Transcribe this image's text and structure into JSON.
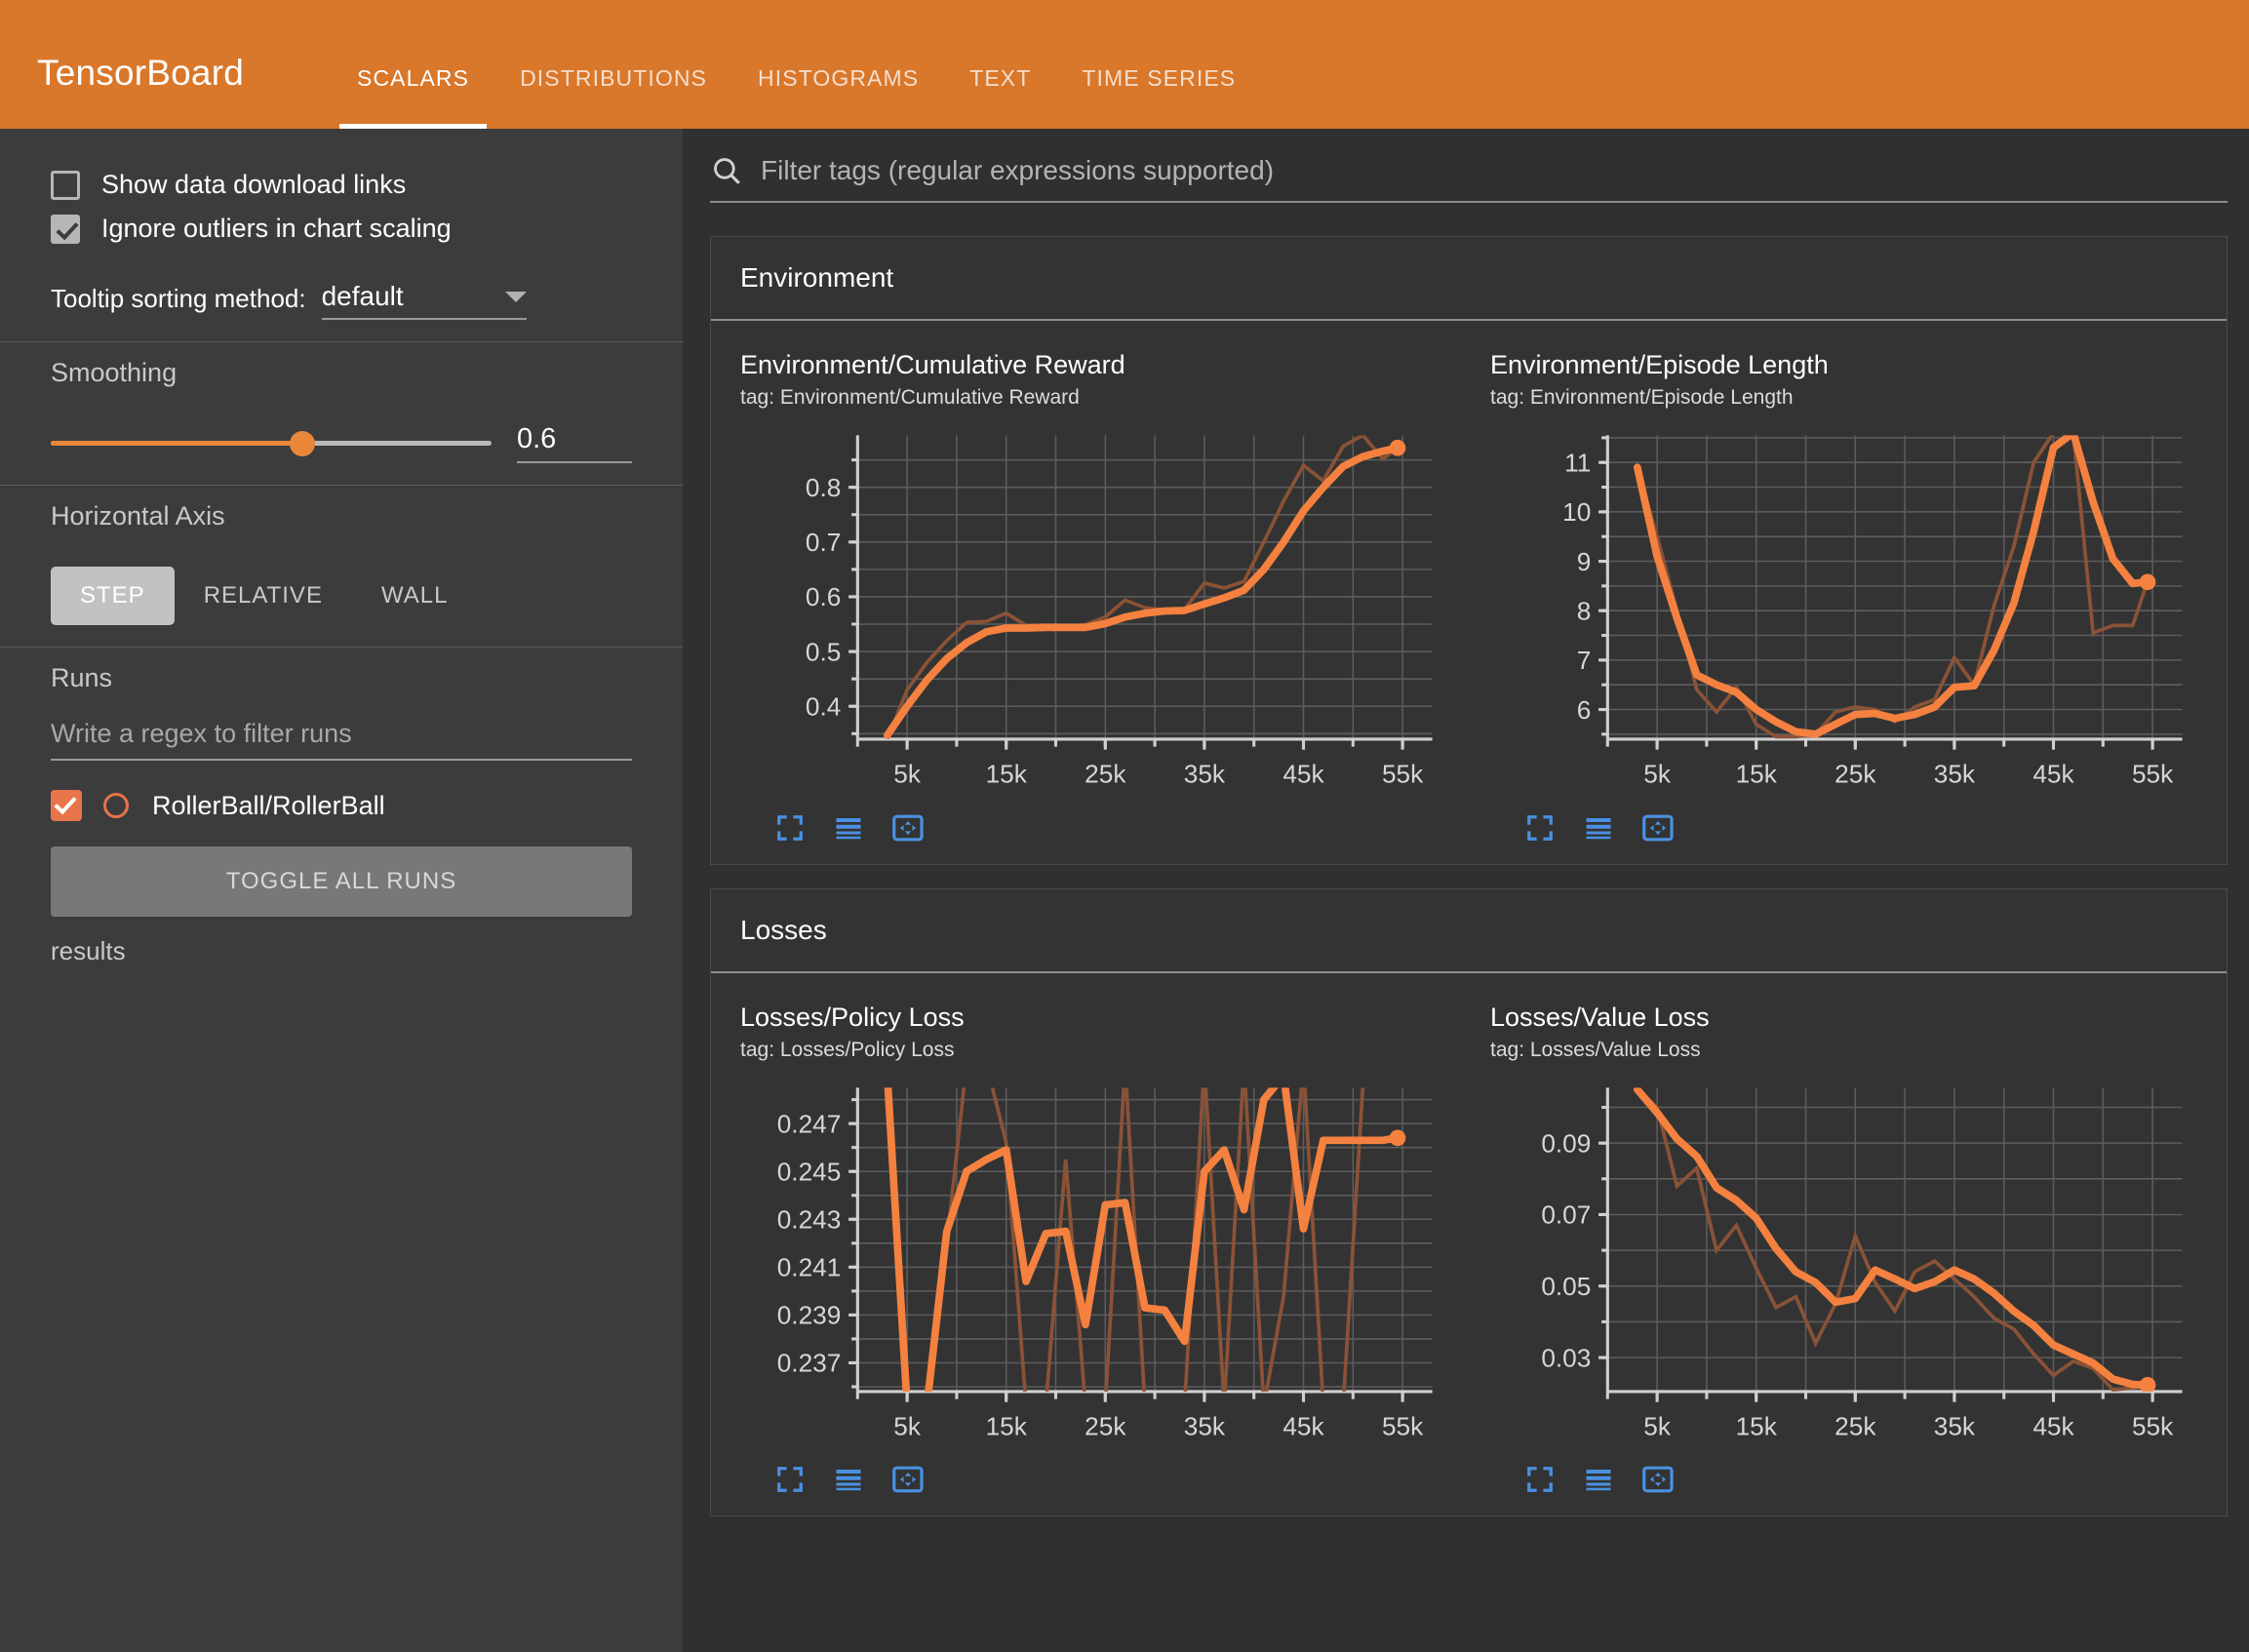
{
  "header": {
    "brand": "TensorBoard",
    "tabs": [
      {
        "label": "SCALARS",
        "active": true
      },
      {
        "label": "DISTRIBUTIONS",
        "active": false
      },
      {
        "label": "HISTOGRAMS",
        "active": false
      },
      {
        "label": "TEXT",
        "active": false
      },
      {
        "label": "TIME SERIES",
        "active": false
      }
    ],
    "accent_color": "#d9772a"
  },
  "sidebar": {
    "show_download_links": {
      "label": "Show data download links",
      "checked": false
    },
    "ignore_outliers": {
      "label": "Ignore outliers in chart scaling",
      "checked": true
    },
    "tooltip_sorting": {
      "label": "Tooltip sorting method:",
      "value": "default"
    },
    "smoothing": {
      "label": "Smoothing",
      "value": "0.6",
      "percent": 57
    },
    "horizontal_axis": {
      "label": "Horizontal Axis",
      "options": [
        "STEP",
        "RELATIVE",
        "WALL"
      ],
      "selected": "STEP"
    },
    "runs": {
      "label": "Runs",
      "filter_placeholder": "Write a regex to filter runs",
      "items": [
        {
          "name": "RollerBall/RollerBall",
          "checked": true,
          "color": "#e8744a"
        }
      ],
      "toggle_label": "TOGGLE ALL RUNS",
      "results_text": "results"
    }
  },
  "main": {
    "filter_placeholder": "Filter tags (regular expressions supported)",
    "groups": [
      {
        "name": "Environment",
        "charts": [
          {
            "title": "Environment/Cumulative Reward",
            "tag": "tag: Environment/Cumulative Reward"
          },
          {
            "title": "Environment/Episode Length",
            "tag": "tag: Environment/Episode Length"
          }
        ]
      },
      {
        "name": "Losses",
        "charts": [
          {
            "title": "Losses/Policy Loss",
            "tag": "tag: Losses/Policy Loss"
          },
          {
            "title": "Losses/Value Loss",
            "tag": "tag: Losses/Value Loss"
          }
        ]
      }
    ],
    "chart_tools": [
      "expand-icon",
      "data-table-icon",
      "pan-icon"
    ]
  },
  "chart_data": [
    {
      "type": "line",
      "title": "Environment/Cumulative Reward",
      "tag": "Environment/Cumulative Reward",
      "xlabel": "",
      "ylabel": "",
      "xlim": [
        0,
        58000
      ],
      "ylim": [
        0.34,
        0.895
      ],
      "xticks": [
        5000,
        15000,
        25000,
        35000,
        45000,
        55000
      ],
      "xticklabels": [
        "5k",
        "15k",
        "25k",
        "35k",
        "45k",
        "55k"
      ],
      "yticks": [
        0.4,
        0.5,
        0.6,
        0.7,
        0.8
      ],
      "yticklabels": [
        "0.4",
        "0.5",
        "0.6",
        "0.7",
        "0.8"
      ],
      "grid": true,
      "legend": false,
      "series": [
        {
          "name": "RollerBall/RollerBall (raw)",
          "color": "#8a5236",
          "x": [
            3000,
            5000,
            7000,
            9000,
            11000,
            13000,
            15000,
            17000,
            19000,
            21000,
            23000,
            25000,
            27000,
            29000,
            31000,
            33000,
            35000,
            37000,
            39000,
            41000,
            43000,
            45000,
            47000,
            49000,
            51000,
            53000,
            54500
          ],
          "y": [
            0.34,
            0.43,
            0.48,
            0.52,
            0.553,
            0.555,
            0.57,
            0.548,
            0.545,
            0.545,
            0.549,
            0.563,
            0.594,
            0.58,
            0.576,
            0.577,
            0.625,
            0.616,
            0.628,
            0.7,
            0.775,
            0.84,
            0.812,
            0.875,
            0.895,
            0.852,
            0.872
          ]
        },
        {
          "name": "RollerBall/RollerBall (smoothed, 0.6)",
          "color": "#f4813f",
          "x": [
            3000,
            5000,
            7000,
            9000,
            11000,
            13000,
            15000,
            17000,
            19000,
            21000,
            23000,
            25000,
            27000,
            29000,
            31000,
            33000,
            35000,
            37000,
            39000,
            41000,
            43000,
            45000,
            47000,
            49000,
            51000,
            53000,
            54500
          ],
          "y": [
            0.347,
            0.4,
            0.448,
            0.487,
            0.516,
            0.536,
            0.543,
            0.543,
            0.544,
            0.544,
            0.544,
            0.551,
            0.563,
            0.57,
            0.574,
            0.575,
            0.587,
            0.598,
            0.612,
            0.65,
            0.7,
            0.757,
            0.8,
            0.838,
            0.856,
            0.866,
            0.872
          ]
        }
      ],
      "endpoint": {
        "x": 54500,
        "y": 0.872
      }
    },
    {
      "type": "line",
      "title": "Environment/Episode Length",
      "tag": "Environment/Episode Length",
      "xlabel": "",
      "ylabel": "",
      "xlim": [
        0,
        58000
      ],
      "ylim": [
        5.4,
        11.55
      ],
      "xticks": [
        5000,
        15000,
        25000,
        35000,
        45000,
        55000
      ],
      "xticklabels": [
        "5k",
        "15k",
        "25k",
        "35k",
        "45k",
        "55k"
      ],
      "yticks": [
        6,
        7,
        8,
        9,
        10,
        11
      ],
      "yticklabels": [
        "6",
        "7",
        "8",
        "9",
        "10",
        "11"
      ],
      "grid": true,
      "legend": false,
      "series": [
        {
          "name": "RollerBall/RollerBall (raw)",
          "color": "#8a5236",
          "x": [
            3000,
            5000,
            7000,
            9000,
            11000,
            13000,
            15000,
            17000,
            19000,
            21000,
            23000,
            25000,
            27000,
            29000,
            31000,
            33000,
            35000,
            37000,
            39000,
            41000,
            43000,
            45000,
            47000,
            49000,
            51000,
            53000,
            54500
          ],
          "y": [
            10.9,
            9.5,
            8.0,
            6.4,
            5.95,
            6.45,
            5.7,
            5.45,
            5.45,
            5.5,
            5.95,
            6.05,
            6.0,
            5.75,
            6.05,
            6.2,
            7.05,
            6.5,
            8.1,
            9.3,
            11.0,
            11.6,
            11.6,
            7.55,
            7.7,
            7.7,
            8.6
          ]
        },
        {
          "name": "RollerBall/RollerBall (smoothed, 0.6)",
          "color": "#f4813f",
          "x": [
            3000,
            5000,
            7000,
            9000,
            11000,
            13000,
            15000,
            17000,
            19000,
            21000,
            23000,
            25000,
            27000,
            29000,
            31000,
            33000,
            35000,
            37000,
            39000,
            41000,
            43000,
            45000,
            47000,
            49000,
            51000,
            53000,
            54500
          ],
          "y": [
            10.9,
            9.1,
            7.85,
            6.7,
            6.5,
            6.35,
            6.0,
            5.75,
            5.55,
            5.5,
            5.7,
            5.9,
            5.92,
            5.82,
            5.9,
            6.05,
            6.45,
            6.48,
            7.2,
            8.15,
            9.6,
            11.3,
            11.6,
            10.2,
            9.05,
            8.55,
            8.58
          ]
        }
      ],
      "endpoint": {
        "x": 54500,
        "y": 8.58
      }
    },
    {
      "type": "line",
      "title": "Losses/Policy Loss",
      "tag": "Losses/Policy Loss",
      "xlabel": "",
      "ylabel": "",
      "xlim": [
        0,
        58000
      ],
      "ylim": [
        0.2358,
        0.2485
      ],
      "xticks": [
        5000,
        15000,
        25000,
        35000,
        45000,
        55000
      ],
      "xticklabels": [
        "5k",
        "15k",
        "25k",
        "35k",
        "45k",
        "55k"
      ],
      "yticks": [
        0.237,
        0.239,
        0.241,
        0.243,
        0.245,
        0.247
      ],
      "yticklabels": [
        "0.237",
        "0.239",
        "0.241",
        "0.243",
        "0.245",
        "0.247"
      ],
      "grid": true,
      "legend": false,
      "series": [
        {
          "name": "RollerBall/RollerBall (raw)",
          "color": "#8a5236",
          "x": [
            3000,
            5000,
            7000,
            9000,
            11000,
            13000,
            15000,
            17000,
            19000,
            21000,
            23000,
            25000,
            27000,
            29000,
            31000,
            33000,
            35000,
            37000,
            39000,
            41000,
            43000,
            45000,
            47000,
            49000,
            51000,
            53000,
            54500
          ],
          "y": [
            0.2495,
            0.2352,
            0.2352,
            0.242,
            0.2495,
            0.2495,
            0.2462,
            0.2352,
            0.2352,
            0.2455,
            0.2352,
            0.2352,
            0.2495,
            0.2352,
            0.2352,
            0.2352,
            0.2495,
            0.2352,
            0.2495,
            0.2352,
            0.2398,
            0.2495,
            0.2352,
            0.2352,
            0.2486,
            0.2486,
            0.2486
          ]
        },
        {
          "name": "RollerBall/RollerBall (smoothed, 0.6)",
          "color": "#f4813f",
          "x": [
            3000,
            5000,
            7000,
            9000,
            11000,
            13000,
            15000,
            17000,
            19000,
            21000,
            23000,
            25000,
            27000,
            29000,
            31000,
            33000,
            35000,
            37000,
            39000,
            41000,
            43000,
            45000,
            47000,
            49000,
            51000,
            53000,
            54500
          ],
          "y": [
            0.249,
            0.2352,
            0.2352,
            0.2425,
            0.245,
            0.2455,
            0.2459,
            0.2404,
            0.2424,
            0.2425,
            0.2386,
            0.2436,
            0.2437,
            0.2393,
            0.2392,
            0.2379,
            0.245,
            0.2459,
            0.2434,
            0.248,
            0.249,
            0.2426,
            0.2463,
            0.2463,
            0.2463,
            0.2463,
            0.2464
          ]
        }
      ],
      "endpoint": {
        "x": 54500,
        "y": 0.2464
      }
    },
    {
      "type": "line",
      "title": "Losses/Value Loss",
      "tag": "Losses/Value Loss",
      "xlabel": "",
      "ylabel": "",
      "xlim": [
        0,
        58000
      ],
      "ylim": [
        0.0205,
        0.1055
      ],
      "xticks": [
        5000,
        15000,
        25000,
        35000,
        45000,
        55000
      ],
      "xticklabels": [
        "5k",
        "15k",
        "25k",
        "35k",
        "45k",
        "55k"
      ],
      "yticks": [
        0.03,
        0.05,
        0.07,
        0.09
      ],
      "yticklabels": [
        "0.03",
        "0.05",
        "0.07",
        "0.09"
      ],
      "grid": true,
      "legend": false,
      "series": [
        {
          "name": "RollerBall/RollerBall (raw)",
          "color": "#8a5236",
          "x": [
            3000,
            5000,
            7000,
            9000,
            11000,
            13000,
            15000,
            17000,
            19000,
            21000,
            23000,
            25000,
            27000,
            29000,
            31000,
            33000,
            35000,
            37000,
            39000,
            41000,
            43000,
            45000,
            47000,
            49000,
            51000,
            53000,
            54500
          ],
          "y": [
            0.105,
            0.1,
            0.078,
            0.083,
            0.06,
            0.067,
            0.055,
            0.044,
            0.047,
            0.034,
            0.045,
            0.064,
            0.051,
            0.043,
            0.054,
            0.057,
            0.052,
            0.047,
            0.041,
            0.038,
            0.031,
            0.025,
            0.029,
            0.027,
            0.021,
            0.0215,
            0.022
          ]
        },
        {
          "name": "RollerBall/RollerBall (smoothed, 0.6)",
          "color": "#f4813f",
          "x": [
            3000,
            5000,
            7000,
            9000,
            11000,
            13000,
            15000,
            17000,
            19000,
            21000,
            23000,
            25000,
            27000,
            29000,
            31000,
            33000,
            35000,
            37000,
            39000,
            41000,
            43000,
            45000,
            47000,
            49000,
            51000,
            53000,
            54500
          ],
          "y": [
            0.105,
            0.0985,
            0.0912,
            0.0863,
            0.0775,
            0.074,
            0.069,
            0.0605,
            0.054,
            0.051,
            0.0455,
            0.0465,
            0.0545,
            0.052,
            0.0493,
            0.0512,
            0.0545,
            0.052,
            0.048,
            0.043,
            0.039,
            0.0335,
            0.031,
            0.0285,
            0.024,
            0.0225,
            0.0223
          ]
        }
      ],
      "endpoint": {
        "x": 54500,
        "y": 0.0223
      }
    }
  ]
}
